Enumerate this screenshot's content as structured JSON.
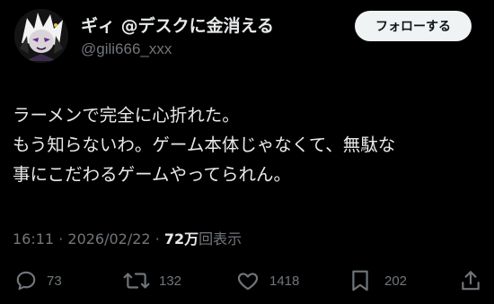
{
  "user": {
    "display_name": "ギィ @デスクに金消える",
    "handle": "@gili666_xxx",
    "follow_label": "フォローする"
  },
  "tweet": {
    "lines": [
      "ラーメンで完全に心折れた。",
      "もう知らないわ。ゲーム本体じゃなくて、無駄な",
      "事にこだわるゲームやってられん。"
    ]
  },
  "meta": {
    "time": "16:11",
    "separator": "·",
    "date": "2026/02/22",
    "views_count": "72万",
    "views_label": "回表示"
  },
  "actions": {
    "replies": "73",
    "reposts": "132",
    "likes": "1418",
    "bookmarks": "202"
  },
  "icons": {
    "reply": "reply-icon",
    "repost": "repost-icon",
    "like": "heart-icon",
    "bookmark": "bookmark-icon",
    "share": "share-icon"
  },
  "colors": {
    "background": "#000000",
    "text": "#e7e9ea",
    "secondary": "#71767b",
    "follow_bg": "#eff3f4"
  }
}
